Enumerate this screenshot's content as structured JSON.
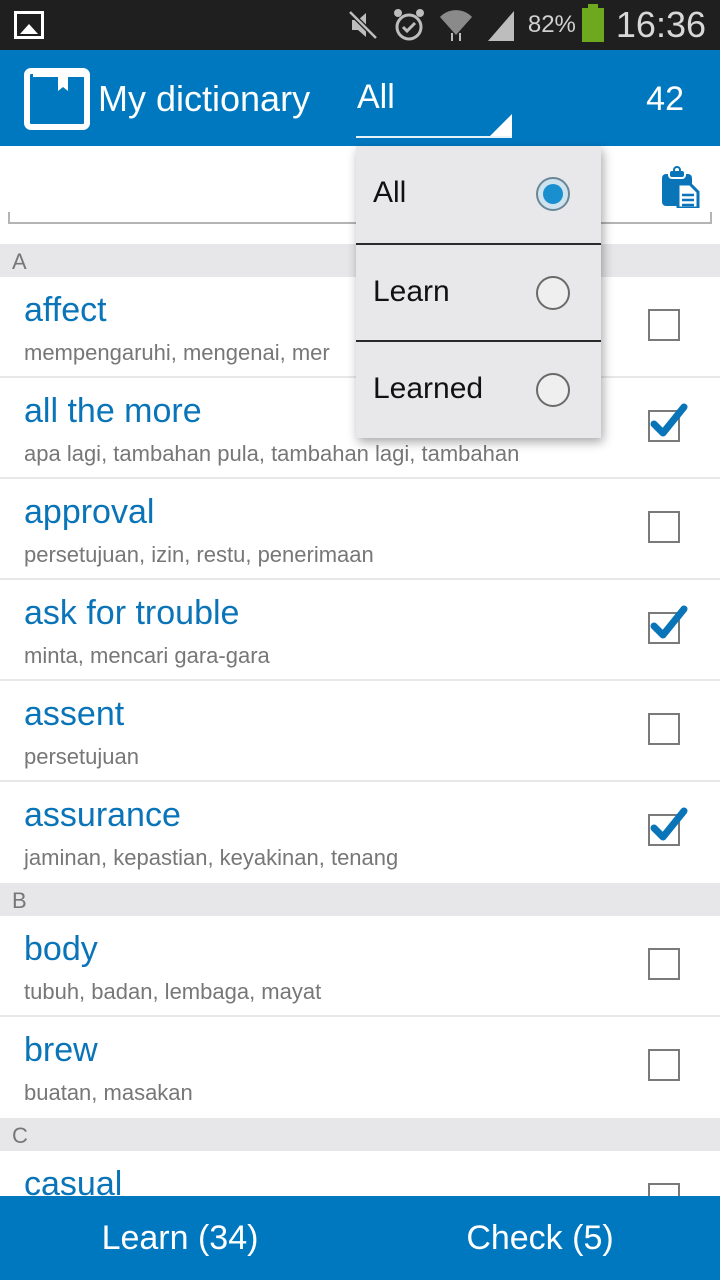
{
  "status_bar": {
    "battery_percent": "82%",
    "time": "16:36",
    "icons": [
      "gallery-icon",
      "mute-icon",
      "alarm-icon",
      "wifi-icon",
      "signal-icon",
      "battery-icon"
    ]
  },
  "app_bar": {
    "title": "My dictionary",
    "filter_selected": "All",
    "word_count": "42"
  },
  "search": {
    "value": "",
    "placeholder": ""
  },
  "filter_dropdown": {
    "options": [
      {
        "label": "All",
        "selected": true
      },
      {
        "label": "Learn",
        "selected": false
      },
      {
        "label": "Learned",
        "selected": false
      }
    ]
  },
  "sections": [
    {
      "letter": "A",
      "entries": [
        {
          "word": "affect",
          "translation": "mempengaruhi, mengenai, mer",
          "learned": false
        },
        {
          "word": "all the more",
          "translation": "apa lagi, tambahan pula, tambahan lagi, tambahan",
          "learned": true
        },
        {
          "word": "approval",
          "translation": "persetujuan, izin, restu, penerimaan",
          "learned": false
        },
        {
          "word": "ask for trouble",
          "translation": "minta, mencari gara-gara",
          "learned": true
        },
        {
          "word": "assent",
          "translation": "persetujuan",
          "learned": false
        },
        {
          "word": "assurance",
          "translation": "jaminan, kepastian, keyakinan, tenang",
          "learned": true
        }
      ]
    },
    {
      "letter": "B",
      "entries": [
        {
          "word": "body",
          "translation": "tubuh, badan, lembaga, mayat",
          "learned": false
        },
        {
          "word": "brew",
          "translation": "buatan, masakan",
          "learned": false
        }
      ]
    },
    {
      "letter": "C",
      "entries": [
        {
          "word": "casual",
          "translation": "",
          "learned": false
        }
      ]
    }
  ],
  "bottom_bar": {
    "learn_label": "Learn (34)",
    "check_label": "Check (5)"
  },
  "colors": {
    "primary": "#0078c0",
    "word_text": "#0a74b8",
    "radio_selected": "#1a8fd0"
  }
}
